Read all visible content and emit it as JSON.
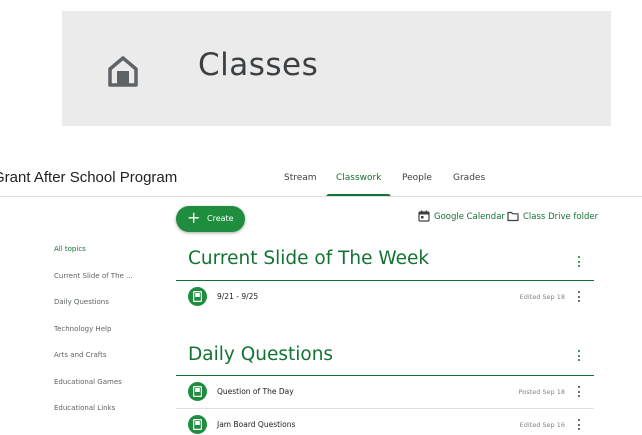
{
  "banner": {
    "title": "Classes",
    "icon": "home-icon"
  },
  "header": {
    "class_name": "Grant After School Program",
    "tabs": [
      {
        "label": "Stream",
        "active": false
      },
      {
        "label": "Classwork",
        "active": true
      },
      {
        "label": "People",
        "active": false
      },
      {
        "label": "Grades",
        "active": false
      }
    ]
  },
  "toolbar": {
    "create_label": "Create",
    "calendar_label": "Google Calendar",
    "drive_label": "Class Drive folder"
  },
  "sidebar": {
    "items": [
      {
        "label": "All topics",
        "active": true
      },
      {
        "label": "Current Slide of The ...",
        "active": false
      },
      {
        "label": "Daily Questions",
        "active": false
      },
      {
        "label": "Technology Help",
        "active": false
      },
      {
        "label": "Arts and Crafts",
        "active": false
      },
      {
        "label": "Educational Games",
        "active": false
      },
      {
        "label": "Educational Links",
        "active": false
      }
    ]
  },
  "topics": [
    {
      "title": "Current Slide of The Week",
      "items": [
        {
          "title": "9/21 - 9/25",
          "meta": "Edited Sep 18"
        }
      ]
    },
    {
      "title": "Daily Questions",
      "items": [
        {
          "title": "Question of The Day",
          "meta": "Posted Sep 18"
        },
        {
          "title": "Jam Board Questions",
          "meta": "Edited Sep 16"
        }
      ]
    }
  ],
  "colors": {
    "accent": "#137333",
    "button": "#1e8e3e",
    "banner_bg": "#ebebeb"
  }
}
